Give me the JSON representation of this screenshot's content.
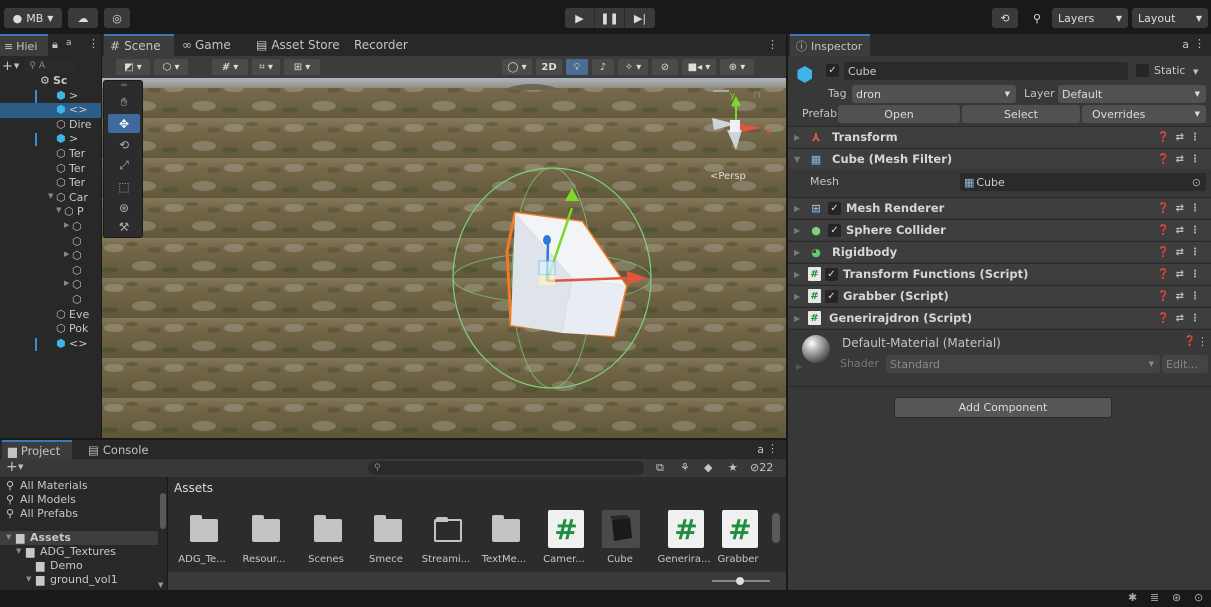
{
  "topbar": {
    "account_label": "MB",
    "layers_label": "Layers",
    "layout_label": "Layout"
  },
  "hierarchy": {
    "tab_label": "Hiei",
    "search_placeholder": "A",
    "rows": [
      {
        "label": "Sc",
        "indent": 0
      },
      {
        "label": ">",
        "indent": 1
      },
      {
        "label": "<>",
        "indent": 1
      },
      {
        "label": "Dire",
        "indent": 1
      },
      {
        "label": ">",
        "indent": 1
      },
      {
        "label": "Ter",
        "indent": 1
      },
      {
        "label": "Ter",
        "indent": 1
      },
      {
        "label": "Ter",
        "indent": 1
      },
      {
        "label": "Car",
        "indent": 1
      },
      {
        "label": "P",
        "indent": 2
      },
      {
        "label": "",
        "indent": 3
      },
      {
        "label": "",
        "indent": 3
      },
      {
        "label": "",
        "indent": 3
      },
      {
        "label": "",
        "indent": 3
      },
      {
        "label": "",
        "indent": 3
      },
      {
        "label": "",
        "indent": 3
      },
      {
        "label": "Eve",
        "indent": 1
      },
      {
        "label": "Pok",
        "indent": 1
      },
      {
        "label": "<>",
        "indent": 1
      }
    ]
  },
  "scene": {
    "tabs": [
      "Scene",
      "Game",
      "Asset Store",
      "Recorder"
    ],
    "mode_2d": "2D",
    "gizmo_persp": "<Persp",
    "gizmo_axes": {
      "x": "x",
      "y": "y"
    }
  },
  "inspector": {
    "tab_label": "Inspector",
    "object_name": "Cube",
    "static_label": "Static",
    "tag_label": "Tag",
    "tag_value": "dron",
    "layer_label": "Layer",
    "layer_value": "Default",
    "prefab_label": "Prefab",
    "prefab_open": "Open",
    "prefab_select": "Select",
    "prefab_overrides": "Overrides",
    "components": [
      {
        "name": "Transform",
        "checkbox": false,
        "icon": "transform-icon"
      },
      {
        "name": "Cube (Mesh Filter)",
        "checkbox": false,
        "icon": "mesh-filter-icon"
      },
      {
        "name": "Mesh Renderer",
        "checkbox": true,
        "icon": "mesh-renderer-icon"
      },
      {
        "name": "Sphere Collider",
        "checkbox": true,
        "icon": "sphere-collider-icon"
      },
      {
        "name": "Rigidbody",
        "checkbox": false,
        "icon": "rigidbody-icon"
      },
      {
        "name": "Transform Functions (Script)",
        "checkbox": true,
        "icon": "script-icon"
      },
      {
        "name": "Grabber (Script)",
        "checkbox": true,
        "icon": "script-icon"
      },
      {
        "name": "Generirajdron (Script)",
        "checkbox": false,
        "icon": "script-icon"
      }
    ],
    "mesh_label": "Mesh",
    "mesh_value": "Cube",
    "material_name": "Default-Material (Material)",
    "shader_label": "Shader",
    "shader_value": "Standard",
    "edit_label": "Edit...",
    "add_component": "Add Component"
  },
  "project": {
    "tabs": [
      "Project",
      "Console"
    ],
    "search_placeholder": "",
    "hidden_count": "22",
    "sidebar_items": [
      {
        "label": "All Materials",
        "type": "search",
        "indent": 0
      },
      {
        "label": "All Models",
        "type": "search",
        "indent": 0
      },
      {
        "label": "All Prefabs",
        "type": "search",
        "indent": 0
      },
      {
        "label": "Assets",
        "type": "root",
        "indent": 0
      },
      {
        "label": "ADG_Textures",
        "type": "folder",
        "indent": 1
      },
      {
        "label": "Demo",
        "type": "folder",
        "indent": 2
      },
      {
        "label": "ground_vol1",
        "type": "folder",
        "indent": 2
      }
    ],
    "breadcrumb": "Assets",
    "assets": [
      {
        "label": "ADG_Te...",
        "kind": "folder"
      },
      {
        "label": "Resour...",
        "kind": "folder"
      },
      {
        "label": "Scenes",
        "kind": "folder"
      },
      {
        "label": "Smece",
        "kind": "folder"
      },
      {
        "label": "Streami...",
        "kind": "empty-folder"
      },
      {
        "label": "TextMe...",
        "kind": "folder"
      },
      {
        "label": "Camer...",
        "kind": "script"
      },
      {
        "label": "Cube",
        "kind": "prefab"
      },
      {
        "label": "Generira...",
        "kind": "script"
      },
      {
        "label": "Grabber",
        "kind": "script"
      }
    ]
  },
  "colors": {
    "accent": "#3a79bb",
    "selection": "#2c5d87",
    "cube_fill": "#e9edf3",
    "outline": "#f27a22",
    "collider": "#7bd47b"
  }
}
